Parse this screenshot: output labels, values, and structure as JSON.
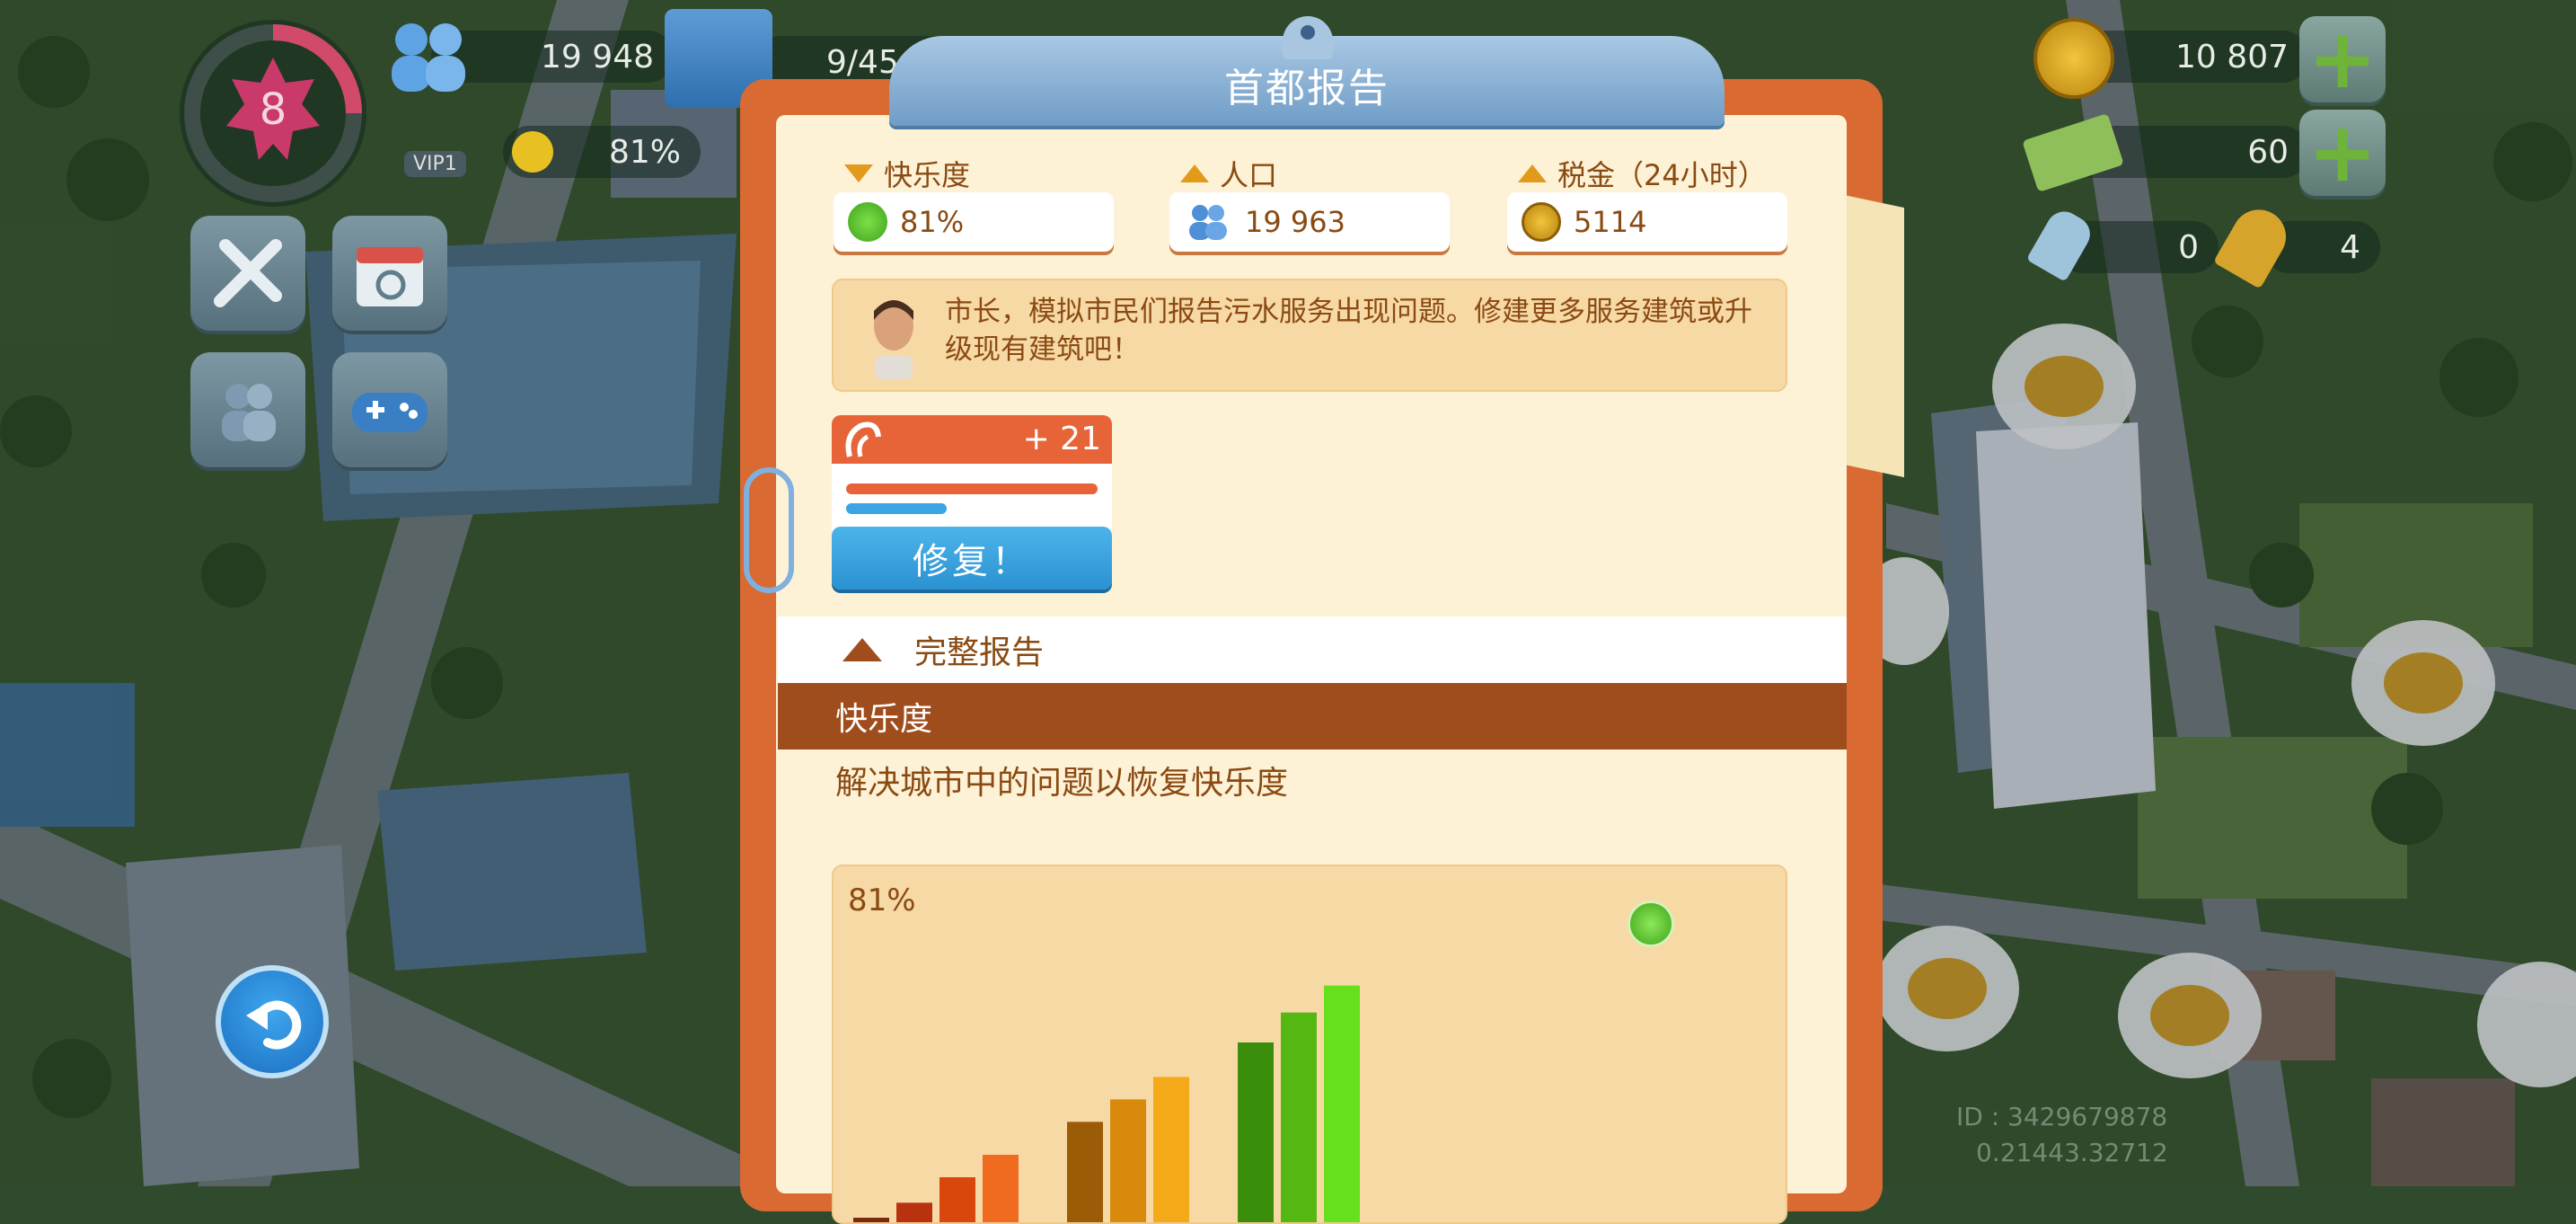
{
  "hud": {
    "level": "8",
    "population": "19 948",
    "storage": "9/45",
    "happiness": "81%",
    "vip_label": "VIP1",
    "simoleons": "10 807",
    "simcash": "60",
    "golden_keys": "0",
    "platinum_keys": "4"
  },
  "panel": {
    "title": "首都报告",
    "stats": {
      "happiness_label": "快乐度",
      "happiness_value": "81%",
      "population_label": "人口",
      "population_value": "19 963",
      "tax_label": "税金（24小时）",
      "tax_value": "5114"
    },
    "advisor_message": "市长，模拟市民们报告污水服务出现问题。修建更多服务建筑或升级现有建筑吧！",
    "issue": {
      "count": "+ 21",
      "fix_label": "修复！"
    },
    "full_report_label": "完整报告",
    "section_title": "快乐度",
    "section_description": "解决城市中的问题以恢复快乐度"
  },
  "chart_data": {
    "type": "bar",
    "label": "81%",
    "groups": [
      {
        "colors": [
          "#7a2a10",
          "#b8320f",
          "#d9470f",
          "#f06a20"
        ],
        "values": [
          3,
          13,
          30,
          45
        ]
      },
      {
        "colors": [
          "#9a5c06",
          "#d98a0c",
          "#f4aa18"
        ],
        "values": [
          67,
          82,
          97
        ]
      },
      {
        "colors": [
          "#3b8d0c",
          "#55b812",
          "#66e01c"
        ],
        "values": [
          120,
          140,
          158
        ]
      }
    ],
    "ylim": [
      0,
      180
    ]
  },
  "debug": {
    "id": "ID : 3429679878",
    "version": "0.21443.32712"
  },
  "colors": {
    "panel_orange": "#d86a32",
    "section_brown": "#a04d1e",
    "fix_blue": "#2b92d2",
    "text_brown": "#8a4a12"
  }
}
